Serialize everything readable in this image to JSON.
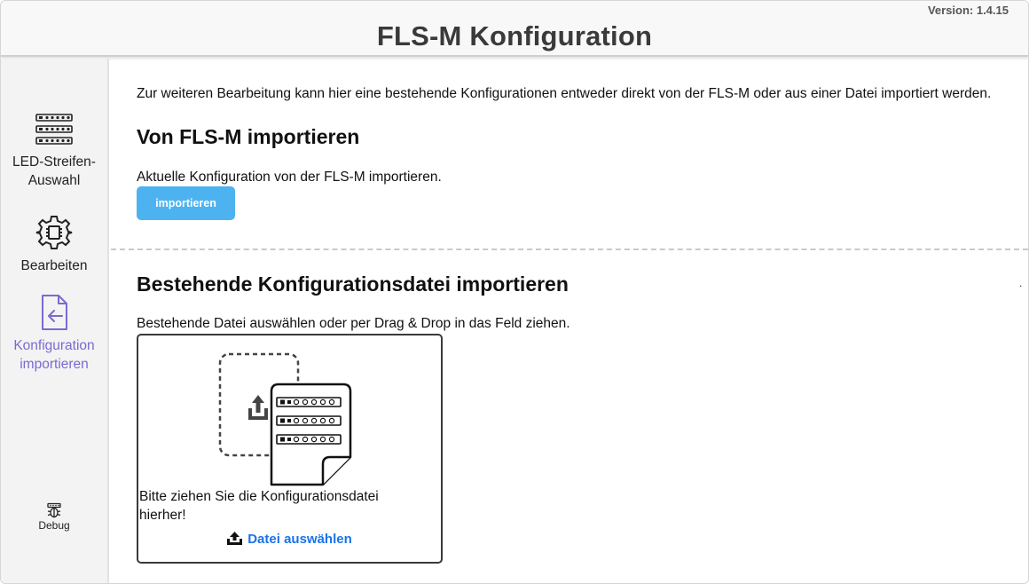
{
  "header": {
    "version": "Version: 1.4.15",
    "title": "FLS-M Konfiguration"
  },
  "sidebar": {
    "items": [
      {
        "label": "LED-Streifen-Auswahl",
        "icon": "led-strip-icon",
        "active": false
      },
      {
        "label": "Bearbeiten",
        "icon": "gear-chip-icon",
        "active": false
      },
      {
        "label": "Konfiguration importieren",
        "icon": "file-import-icon",
        "active": true
      }
    ],
    "debug": {
      "label": "Debug",
      "icon": "bug-icon"
    }
  },
  "main": {
    "intro": "Zur weiteren Bearbeitung kann hier eine bestehende Konfigurationen entweder direkt von der FLS-M oder aus einer Datei importiert werden.",
    "device_section": {
      "title": "Von FLS-M importieren",
      "description": "Aktuelle Konfiguration von der FLS-M importieren.",
      "button_label": "importieren"
    },
    "file_section": {
      "title": "Bestehende Konfigurationsdatei importieren",
      "marker": ".",
      "description": "Bestehende Datei auswählen oder per Drag & Drop in das Feld ziehen.",
      "dropzone_text": "Bitte ziehen Sie die Konfigurationsdatei hierher!",
      "choose_file_label": "Datei auswählen"
    }
  },
  "colors": {
    "accent": "#7b6ad1",
    "button": "#4db3f0",
    "link": "#1a73e8"
  }
}
